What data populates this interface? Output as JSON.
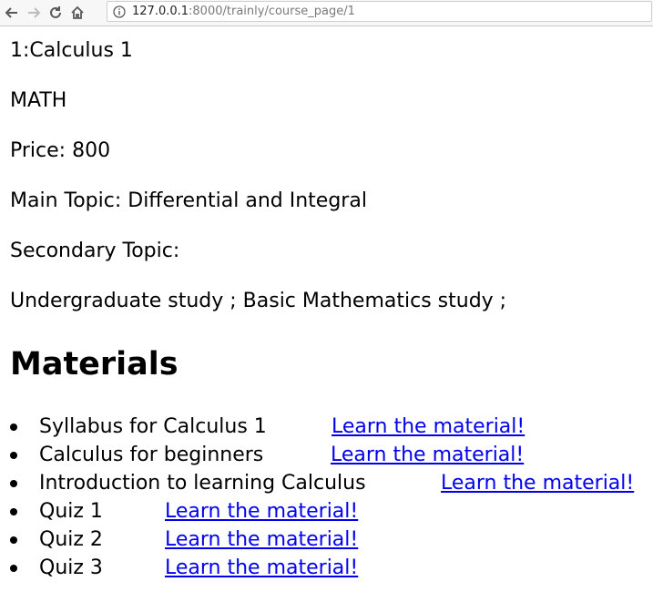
{
  "browser": {
    "url_host": "127.0.0.1",
    "url_path": ":8000/trainly/course_page/1"
  },
  "course": {
    "title": "1:Calculus 1",
    "department": "MATH",
    "price": "Price: 800",
    "main_topic": "Main Topic: Differential and Integral",
    "secondary_topic_label": "Secondary Topic:",
    "secondary_topics": "Undergraduate study ; Basic Mathematics study ;"
  },
  "materials": {
    "heading": "Materials",
    "items": [
      {
        "name": "Syllabus for Calculus 1",
        "link": "Learn the material!"
      },
      {
        "name": "Calculus for beginners",
        "link": "Learn the material!"
      },
      {
        "name": "Introduction to learning Calculus",
        "link": "Learn the material!"
      },
      {
        "name": "Quiz 1",
        "link": "Learn the material!"
      },
      {
        "name": "Quiz 2",
        "link": "Learn the material!"
      },
      {
        "name": "Quiz 3",
        "link": "Learn the material!"
      }
    ]
  },
  "colors": {
    "link": "#0000ee"
  }
}
